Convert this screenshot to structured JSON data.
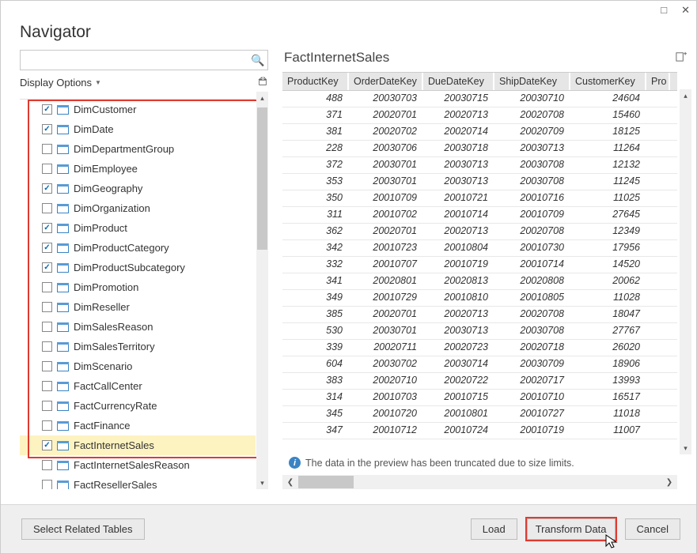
{
  "window": {
    "title": "Navigator"
  },
  "left": {
    "search_placeholder": "",
    "display_options_label": "Display Options",
    "items": [
      {
        "label": "DimCustomer",
        "checked": true
      },
      {
        "label": "DimDate",
        "checked": true
      },
      {
        "label": "DimDepartmentGroup",
        "checked": false
      },
      {
        "label": "DimEmployee",
        "checked": false
      },
      {
        "label": "DimGeography",
        "checked": true
      },
      {
        "label": "DimOrganization",
        "checked": false
      },
      {
        "label": "DimProduct",
        "checked": true
      },
      {
        "label": "DimProductCategory",
        "checked": true
      },
      {
        "label": "DimProductSubcategory",
        "checked": true
      },
      {
        "label": "DimPromotion",
        "checked": false
      },
      {
        "label": "DimReseller",
        "checked": false
      },
      {
        "label": "DimSalesReason",
        "checked": false
      },
      {
        "label": "DimSalesTerritory",
        "checked": false
      },
      {
        "label": "DimScenario",
        "checked": false
      },
      {
        "label": "FactCallCenter",
        "checked": false
      },
      {
        "label": "FactCurrencyRate",
        "checked": false
      },
      {
        "label": "FactFinance",
        "checked": false
      },
      {
        "label": "FactInternetSales",
        "checked": true,
        "selected": true
      },
      {
        "label": "FactInternetSalesReason",
        "checked": false
      },
      {
        "label": "FactResellerSales",
        "checked": false
      }
    ]
  },
  "right": {
    "title": "FactInternetSales",
    "columns": [
      "ProductKey",
      "OrderDateKey",
      "DueDateKey",
      "ShipDateKey",
      "CustomerKey",
      "Pro"
    ],
    "rows": [
      [
        "488",
        "20030703",
        "20030715",
        "20030710",
        "24604"
      ],
      [
        "371",
        "20020701",
        "20020713",
        "20020708",
        "15460"
      ],
      [
        "381",
        "20020702",
        "20020714",
        "20020709",
        "18125"
      ],
      [
        "228",
        "20030706",
        "20030718",
        "20030713",
        "11264"
      ],
      [
        "372",
        "20030701",
        "20030713",
        "20030708",
        "12132"
      ],
      [
        "353",
        "20030701",
        "20030713",
        "20030708",
        "11245"
      ],
      [
        "350",
        "20010709",
        "20010721",
        "20010716",
        "11025"
      ],
      [
        "311",
        "20010702",
        "20010714",
        "20010709",
        "27645"
      ],
      [
        "362",
        "20020701",
        "20020713",
        "20020708",
        "12349"
      ],
      [
        "342",
        "20010723",
        "20010804",
        "20010730",
        "17956"
      ],
      [
        "332",
        "20010707",
        "20010719",
        "20010714",
        "14520"
      ],
      [
        "341",
        "20020801",
        "20020813",
        "20020808",
        "20062"
      ],
      [
        "349",
        "20010729",
        "20010810",
        "20010805",
        "11028"
      ],
      [
        "385",
        "20020701",
        "20020713",
        "20020708",
        "18047"
      ],
      [
        "530",
        "20030701",
        "20030713",
        "20030708",
        "27767"
      ],
      [
        "339",
        "20020711",
        "20020723",
        "20020718",
        "26020"
      ],
      [
        "604",
        "20030702",
        "20030714",
        "20030709",
        "18906"
      ],
      [
        "383",
        "20020710",
        "20020722",
        "20020717",
        "13993"
      ],
      [
        "314",
        "20010703",
        "20010715",
        "20010710",
        "16517"
      ],
      [
        "345",
        "20010720",
        "20010801",
        "20010727",
        "11018"
      ],
      [
        "347",
        "20010712",
        "20010724",
        "20010719",
        "11007"
      ]
    ],
    "info_text": "The data in the preview has been truncated due to size limits."
  },
  "footer": {
    "select_related": "Select Related Tables",
    "load": "Load",
    "transform": "Transform Data",
    "cancel": "Cancel"
  }
}
